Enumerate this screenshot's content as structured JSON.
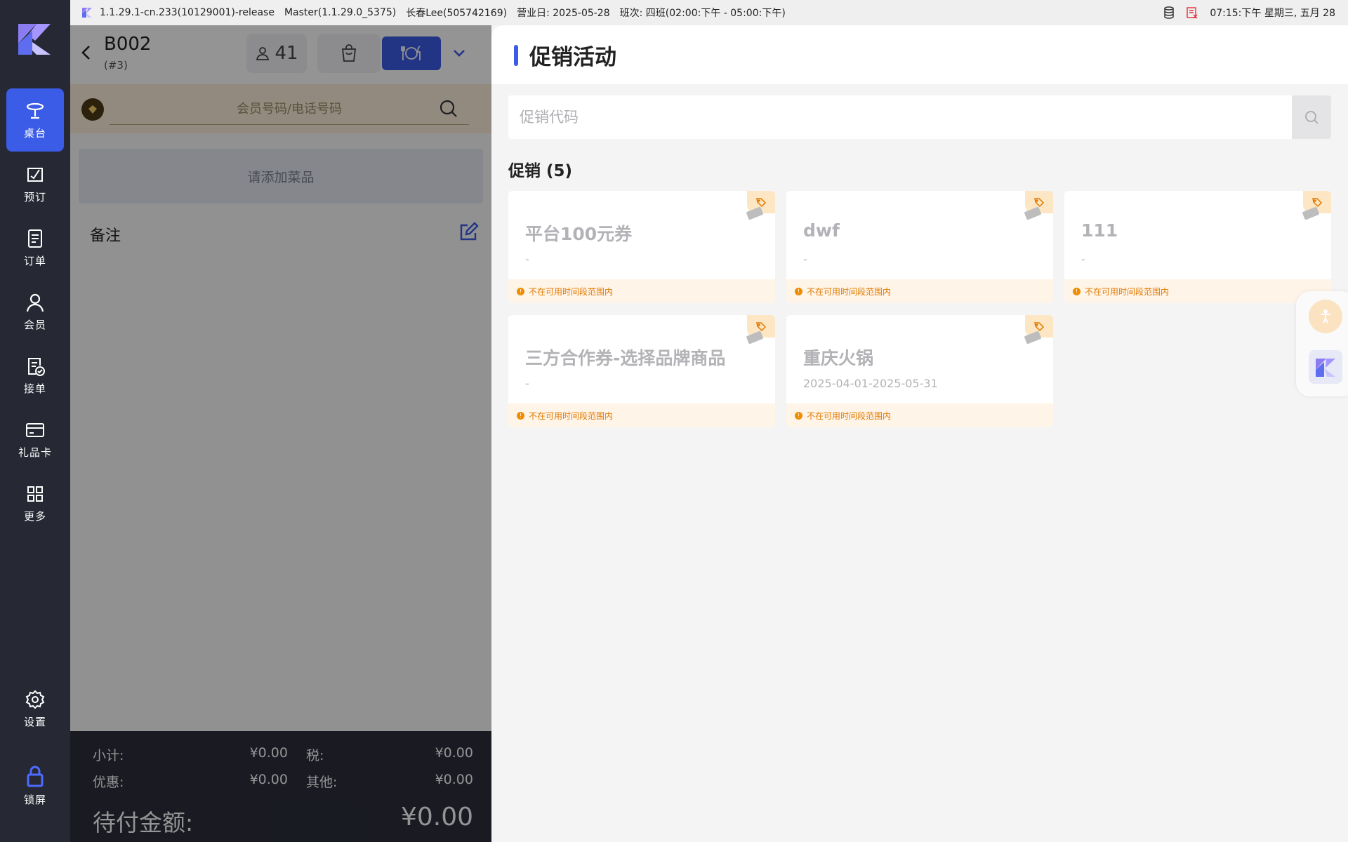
{
  "status_bar": {
    "version": "1.1.29.1-cn.233(10129001)-release",
    "master": "Master(1.1.29.0_5375)",
    "user": "长春Lee(505742169)",
    "business_day": "营业日: 2025-05-28",
    "shift": "班次: 四班(02:00:下午 - 05:00:下午)",
    "datetime": "07:15:下午 星期三, 五月 28",
    "icons": [
      "database-icon",
      "printer-error-icon"
    ]
  },
  "nav": {
    "items": [
      {
        "label": "桌台",
        "icon": "table-icon",
        "active": true
      },
      {
        "label": "预订",
        "icon": "reservation-icon"
      },
      {
        "label": "订单",
        "icon": "orders-icon"
      },
      {
        "label": "会员",
        "icon": "member-icon"
      },
      {
        "label": "接单",
        "icon": "accept-order-icon"
      },
      {
        "label": "礼品卡",
        "icon": "gift-card-icon"
      },
      {
        "label": "更多",
        "icon": "grid-icon"
      },
      {
        "label": "设置",
        "icon": "gear-icon"
      },
      {
        "label": "锁屏",
        "icon": "lock-icon"
      }
    ]
  },
  "order": {
    "table": "B002",
    "table_sub": "(#3)",
    "guests": "41",
    "member_placeholder": "会员号码/电话号码",
    "add_dish": "请添加菜品",
    "notes_label": "备注",
    "totals": {
      "subtotal_label": "小计:",
      "subtotal": "¥0.00",
      "tax_label": "税:",
      "tax": "¥0.00",
      "discount_label": "优惠:",
      "discount": "¥0.00",
      "other_label": "其他:",
      "other": "¥0.00",
      "due_label": "待付金额:",
      "due": "¥0.00"
    }
  },
  "promo": {
    "title": "促销活动",
    "code_placeholder": "促销代码",
    "count_label": "促销 (5)",
    "cards": [
      {
        "name": "平台100元券",
        "period": "-",
        "status": "不在可用时间段范围内"
      },
      {
        "name": "dwf",
        "period": "-",
        "status": "不在可用时间段范围内"
      },
      {
        "name": "111",
        "period": "-",
        "status": "不在可用时间段范围内"
      },
      {
        "name": "三方合作券-选择品牌商品",
        "period": "-",
        "status": "不在可用时间段范围内"
      },
      {
        "name": "重庆火锅",
        "period": "2025-04-01-2025-05-31",
        "status": "不在可用时间段范围内"
      }
    ]
  },
  "colors": {
    "accent": "#3b5ce6",
    "nav_bg": "#262833",
    "warning": "#f08c00",
    "member_bar": "#fbeeda"
  }
}
